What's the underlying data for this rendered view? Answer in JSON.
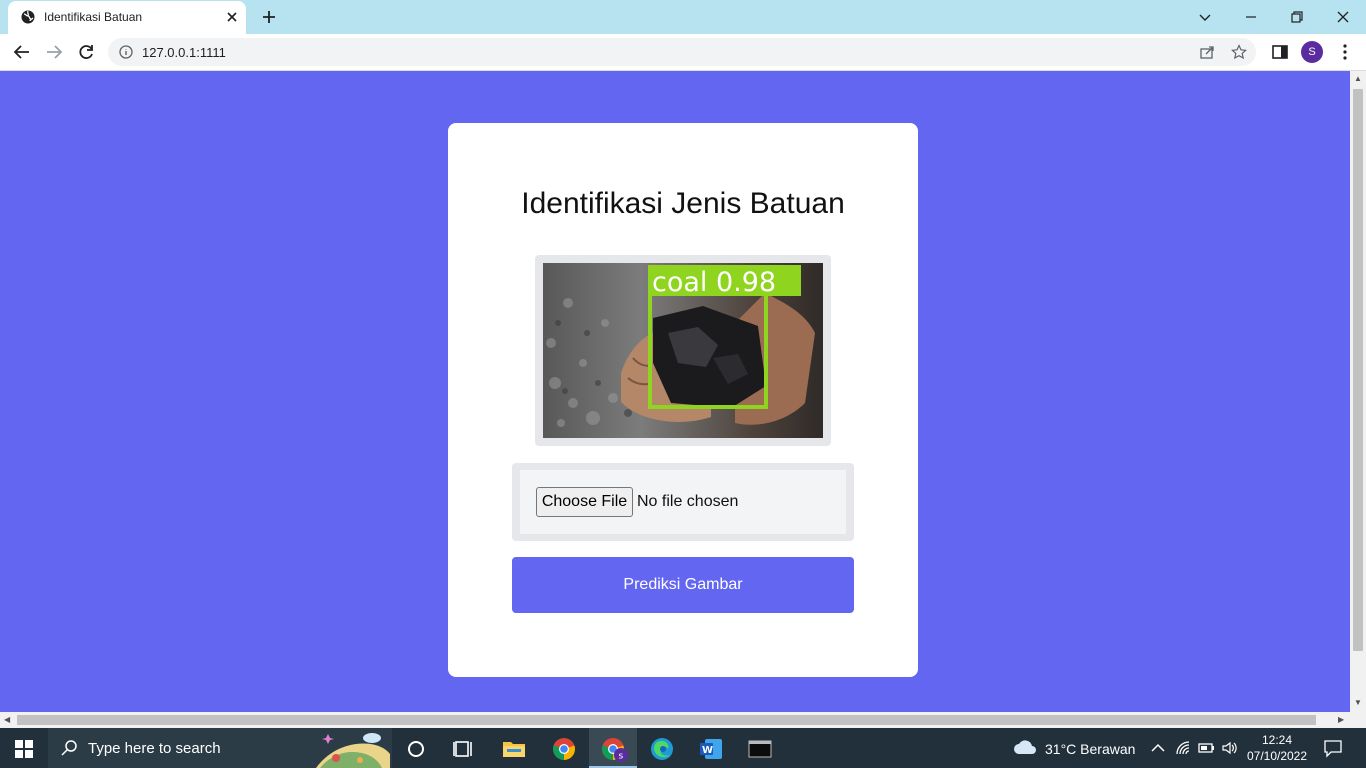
{
  "browser": {
    "tab_title": "Identifikasi Batuan",
    "url": "127.0.0.1:1111",
    "profile_initial": "S"
  },
  "page": {
    "heading": "Identifikasi Jenis Batuan",
    "detection_label": "coal 0.98",
    "file_input": {
      "button_label": "Choose File",
      "status": "No file chosen"
    },
    "submit_label": "Prediksi Gambar"
  },
  "taskbar": {
    "search_placeholder": "Type here to search",
    "weather": "31°C  Berawan",
    "time": "12:24",
    "date": "07/10/2022"
  },
  "colors": {
    "page_background": "#6366f1",
    "button": "#6366f1",
    "detection_box": "#8fd41e"
  }
}
